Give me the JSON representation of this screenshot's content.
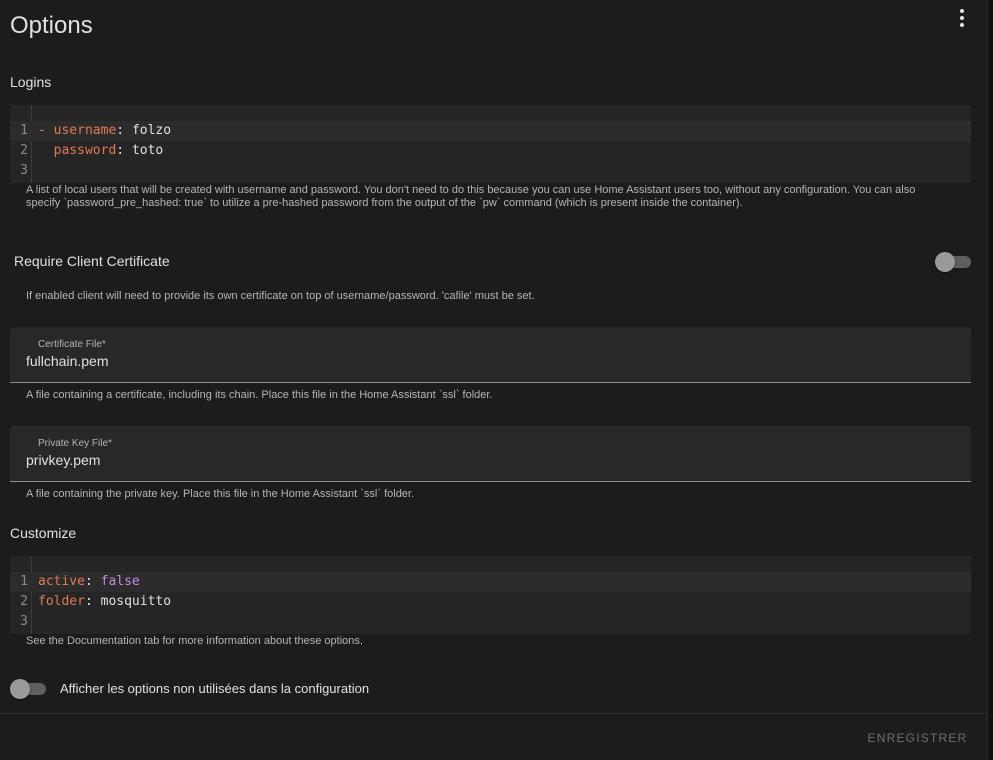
{
  "title": "Options",
  "logins": {
    "label": "Logins",
    "lines": [
      {
        "num": "1",
        "dash": "- ",
        "key": "username",
        "sep": ": ",
        "value": "folzo"
      },
      {
        "num": "2",
        "dash": "  ",
        "key": "password",
        "sep": ": ",
        "value": "toto"
      },
      {
        "num": "3"
      }
    ],
    "helper": "A list of local users that will be created with username and password. You don't need to do this because you can use Home Assistant users too, without any configuration. You can also specify `password_pre_hashed: true` to utilize a pre-hashed password from the output of the `pw` command (which is present inside the container)."
  },
  "require_cert": {
    "label": "Require Client Certificate",
    "enabled": false,
    "helper": "If enabled client will need to provide its own certificate on top of username/password. 'cafile' must be set."
  },
  "certfile": {
    "label": "Certificate File*",
    "value": "fullchain.pem",
    "helper": "A file containing a certificate, including its chain. Place this file in the Home Assistant `ssl` folder."
  },
  "keyfile": {
    "label": "Private Key File*",
    "value": "privkey.pem",
    "helper": "A file containing the private key. Place this file in the Home Assistant `ssl` folder."
  },
  "customize": {
    "label": "Customize",
    "lines": [
      {
        "num": "1",
        "key": "active",
        "sep": ": ",
        "value": "false"
      },
      {
        "num": "2",
        "key": "folder",
        "sep": ": ",
        "value": "mosquitto"
      },
      {
        "num": "3"
      }
    ],
    "helper": "See the Documentation tab for more information about these options."
  },
  "show_unused": {
    "label": "Afficher les options non utilisées dans la configuration",
    "enabled": false
  },
  "save_label": "ENREGISTRER",
  "colors": {
    "background": "#1c1c1c",
    "code_key": "#e07a55",
    "code_bool": "#c78ae0",
    "disabled_text": "#6f6f6f"
  }
}
